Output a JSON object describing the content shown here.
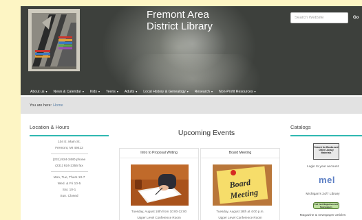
{
  "site": {
    "title_line1": "Fremont Area",
    "title_line2": "District Library"
  },
  "search": {
    "placeholder": "Search Website",
    "button_label": "Go"
  },
  "nav": [
    {
      "label": "About us",
      "has_dropdown": true
    },
    {
      "label": "News & Calendar",
      "has_dropdown": true
    },
    {
      "label": "Kids",
      "has_dropdown": true
    },
    {
      "label": "Teens",
      "has_dropdown": true
    },
    {
      "label": "Adults",
      "has_dropdown": true
    },
    {
      "label": "Local History & Genealogy",
      "has_dropdown": true
    },
    {
      "label": "Research",
      "has_dropdown": true
    },
    {
      "label": "Non-Profit Resources",
      "has_dropdown": true
    }
  ],
  "breadcrumb": {
    "prefix": "You are here:",
    "current": "Home"
  },
  "location": {
    "heading": "Location & Hours",
    "address_line1": "104 E. Main St.",
    "address_line2": "Fremont, MI 49412",
    "phone": "(231) 924-3480 phone",
    "fax": "(231) 924-2355 fax",
    "hours": [
      "Mon, Tue, Thurs 10-7",
      "Wed. & Fri 10-5",
      "Sat. 10-1",
      "Sun. Closed"
    ]
  },
  "events": {
    "heading": "Upcoming Events",
    "items": [
      {
        "title": "Intro to Proposal Writing",
        "date": "Tuesday, August 18th from 10:00-12:00",
        "room": "Upper Level Conference Room"
      },
      {
        "title": "Board Meeting",
        "date": "Tuesday, August 18th at 4:00 p.m.",
        "room": "Upper Level Conference Room",
        "image_text_line1": "Board",
        "image_text_line2": "Meeting"
      }
    ]
  },
  "catalogs": {
    "heading": "Catalogs",
    "search_books_button": "Search for Books and Other Library Materials",
    "login_link": "Login to your account",
    "mel_logo": "mel",
    "mel_link": "Michigan's 24/7 Library",
    "fulltext_button": "Full Text Magazines and Newspapers",
    "magazine_link": "Magazine & newspaper articles"
  },
  "colors": {
    "accent": "#2fb8b0",
    "background": "#fdf5c4",
    "breadcrumb_bg": "#e2e2e2",
    "link": "#5a7fa6"
  }
}
